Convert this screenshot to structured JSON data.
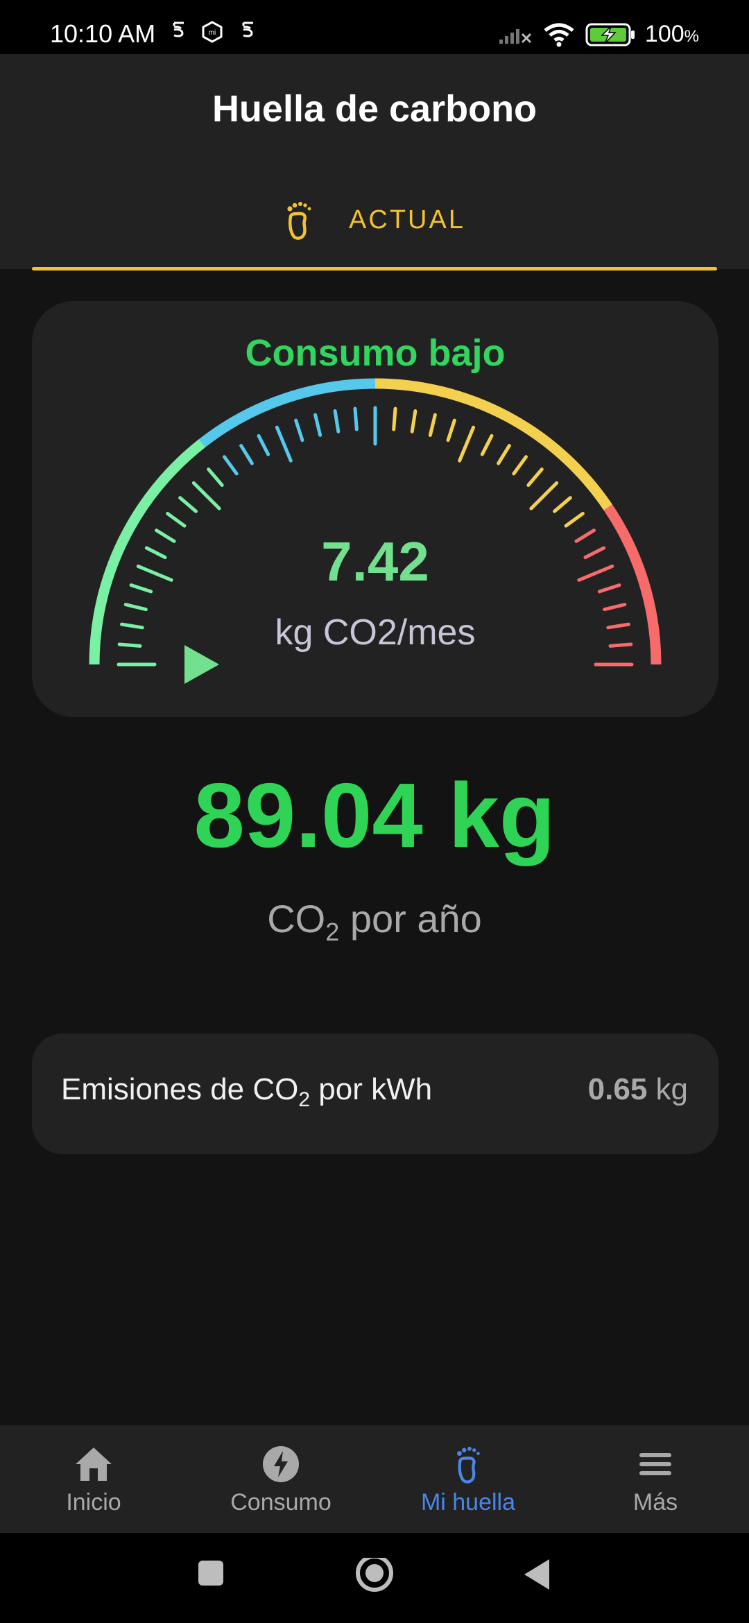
{
  "status_bar": {
    "time": "10:10 AM",
    "battery": "100",
    "battery_unit": "%"
  },
  "header": {
    "title": "Huella de carbono"
  },
  "tabs": [
    {
      "label": "ACTUAL",
      "icon": "footprint-icon"
    }
  ],
  "gauge": {
    "status": "Consumo bajo",
    "value": "7.42",
    "unit": "kg CO2/mes",
    "level": 0.0
  },
  "annual": {
    "value": "89.04 kg",
    "label_prefix": "CO",
    "label_sub": "2",
    "label_suffix": " por año"
  },
  "emissions": {
    "label_prefix": "Emisiones de CO",
    "label_sub": "2",
    "label_suffix": " por kWh",
    "value": "0.65",
    "unit": " kg"
  },
  "bottom_nav": [
    {
      "label": "Inicio",
      "icon": "home-icon"
    },
    {
      "label": "Consumo",
      "icon": "bolt-icon"
    },
    {
      "label": "Mi huella",
      "icon": "footprint-icon",
      "active": true
    },
    {
      "label": "Más",
      "icon": "menu-icon"
    }
  ],
  "colors": {
    "accent": "#f3c234",
    "low": "#2fd356",
    "active_nav": "#4a86e8"
  }
}
